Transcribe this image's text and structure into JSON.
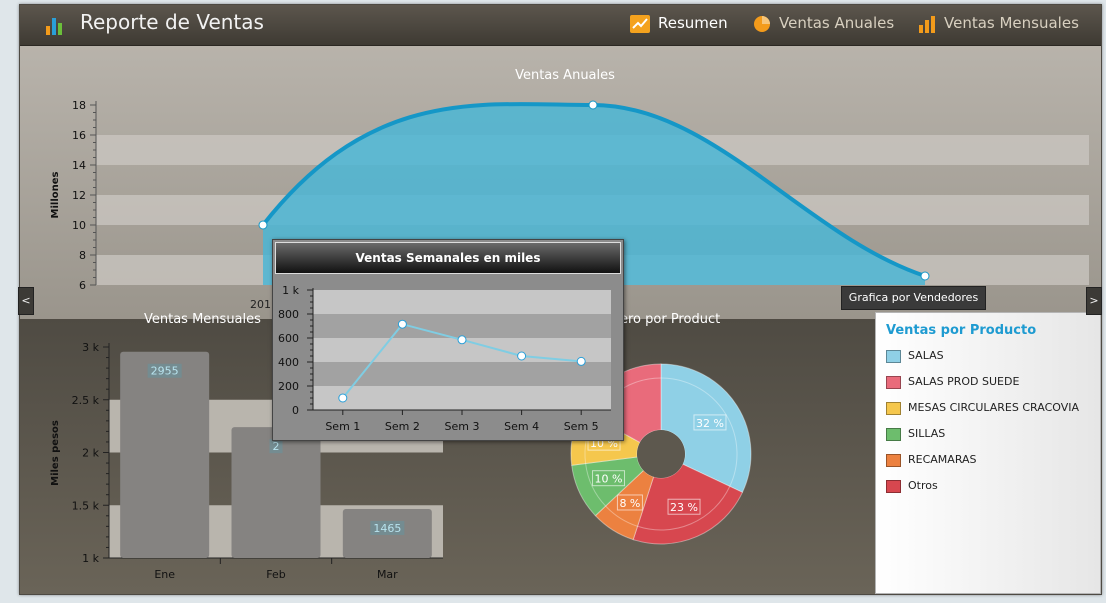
{
  "header": {
    "title": "Reporte de Ventas",
    "nav": [
      {
        "label": "Resumen",
        "icon": "trend-chart-icon"
      },
      {
        "label": "Ventas Anuales",
        "icon": "pie-chart-icon"
      },
      {
        "label": "Ventas Mensuales",
        "icon": "bar-chart-icon"
      }
    ]
  },
  "side_buttons": {
    "left": "<",
    "right": ">"
  },
  "vendor_button": "Grafica por Vendedores",
  "colors": {
    "accent_blue": "#1e9bd1",
    "area_fill": "#53bbd6",
    "bar_gray": "#8a8886"
  },
  "chart_data": [
    {
      "type": "area",
      "title": "Ventas Anuales",
      "ylabel": "Millones",
      "x_visible_labels": [
        "201"
      ],
      "y_ticks": [
        "6",
        "8",
        "10",
        "12",
        "14",
        "16",
        "18"
      ],
      "ylim": [
        6,
        18
      ],
      "points": [
        10,
        18,
        6.6
      ]
    },
    {
      "type": "bar",
      "title": "Ventas Mensuales",
      "ylabel": "Miles pesos",
      "categories": [
        "Ene",
        "Feb",
        "Mar"
      ],
      "values": [
        2955,
        2240,
        1465
      ],
      "value_labels": [
        "2955",
        "2",
        "1465"
      ],
      "y_ticks": [
        "1 k",
        "1.5 k",
        "2 k",
        "2.5 k",
        "3 k"
      ],
      "ylim": [
        1000,
        3000
      ]
    },
    {
      "type": "pie",
      "title": "ero por Product",
      "legend_title": "Ventas por Producto",
      "slices": [
        {
          "name": "SALAS",
          "percent": 32,
          "label": "32 %",
          "color": "#8fd0e6"
        },
        {
          "name": "Otros",
          "percent": 23,
          "label": "23 %",
          "color": "#d7474f"
        },
        {
          "name": "RECAMARAS",
          "percent": 8,
          "label": "8 %",
          "color": "#ec8140"
        },
        {
          "name": "SILLAS",
          "percent": 10,
          "label": "10 %",
          "color": "#6dbd6d"
        },
        {
          "name": "MESAS CIRCULARES CRACOVIA",
          "percent": 10,
          "label": "10 %",
          "color": "#f5c74d"
        },
        {
          "name": "SALAS PROD SUEDE",
          "percent": 17,
          "label": "",
          "color": "#e96b7b"
        }
      ],
      "legend": [
        "SALAS",
        "SALAS PROD SUEDE",
        "MESAS CIRCULARES CRACOVIA",
        "SILLAS",
        "RECAMARAS",
        "Otros"
      ]
    },
    {
      "type": "line",
      "title": "Ventas Semanales en miles",
      "categories": [
        "Sem 1",
        "Sem 2",
        "Sem 3",
        "Sem 4",
        "Sem 5"
      ],
      "values": [
        100,
        715,
        585,
        450,
        405
      ],
      "y_ticks": [
        "0",
        "200",
        "400",
        "600",
        "800",
        "1 k"
      ],
      "ylim": [
        0,
        1000
      ]
    }
  ]
}
